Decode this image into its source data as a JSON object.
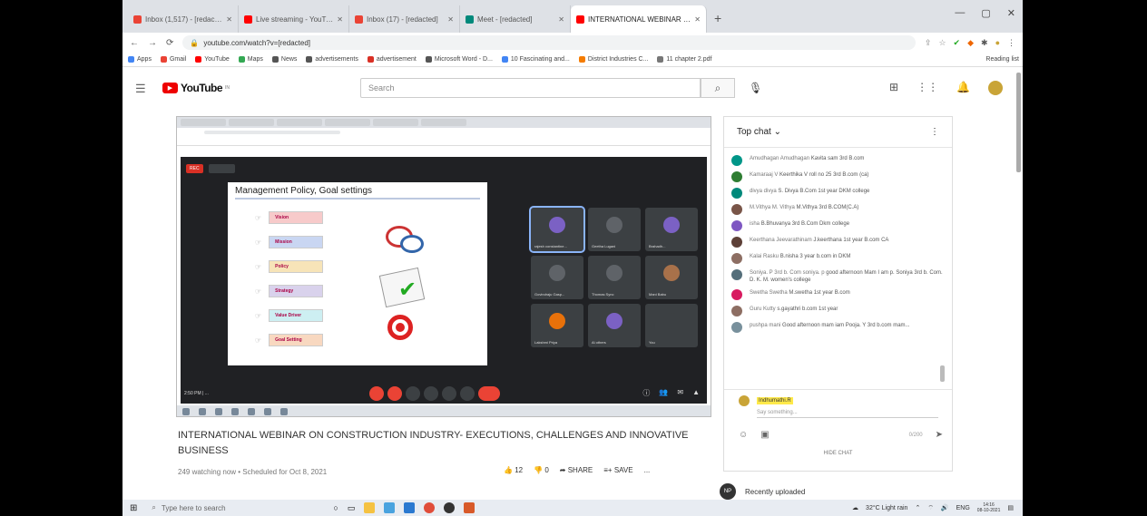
{
  "browser": {
    "tabs": [
      {
        "title": "Inbox (1,517) - [redacted]",
        "color": "#ea4335",
        "active": false
      },
      {
        "title": "Live streaming - YouTube Studio",
        "color": "#ff0000",
        "active": false
      },
      {
        "title": "Inbox (17) - [redacted]",
        "color": "#ea4335",
        "active": false
      },
      {
        "title": "Meet - [redacted]",
        "color": "#00897b",
        "active": false
      },
      {
        "title": "INTERNATIONAL WEBINAR ON C",
        "color": "#ff0000",
        "active": true
      }
    ],
    "url": "youtube.com/watch?v=[redacted]",
    "bookmarks": [
      "Apps",
      "Gmail",
      "YouTube",
      "Maps",
      "News",
      "advertisements",
      "advertisement",
      "Microsoft Word - D...",
      "10 Fascinating and...",
      "District Industries C...",
      "11 chapter 2.pdf"
    ],
    "reading_list": "Reading list"
  },
  "youtube": {
    "logo_text": "YouTube",
    "logo_sup": "IN",
    "search_placeholder": "Search"
  },
  "video": {
    "meeting_rec": "REC",
    "slide_title": "Management Policy, Goal settings",
    "bullets": [
      "Vision",
      "Mission",
      "Policy",
      "Strategy",
      "Value Driver",
      "Goal Setting"
    ],
    "participants": [
      {
        "name": "rajesh constantine...",
        "color": "#7b61c4"
      },
      {
        "name": "Geetha Lugani",
        "color": "#5f6368"
      },
      {
        "name": "Brahadh...",
        "color": "#7b61c4"
      },
      {
        "name": "Govindraju Gasp...",
        "color": "#5f6368"
      },
      {
        "name": "Thomas Sync",
        "color": "#5f6368"
      },
      {
        "name": "Mani Babu",
        "color": "#a8714a"
      },
      {
        "name": "Lakshmi Priya",
        "color": "#e8710a"
      },
      {
        "name": "Al others",
        "color": "#7b61c4"
      },
      {
        "name": "You",
        "color": "#3c4043"
      }
    ],
    "time": "2:50 PM | ..."
  },
  "video_info": {
    "title": "INTERNATIONAL WEBINAR ON CONSTRUCTION INDUSTRY- EXECUTIONS, CHALLENGES AND INNOVATIVE BUSINESS",
    "meta": "249 watching now • Scheduled for Oct 8, 2021",
    "likes": "12",
    "dislikes": "0",
    "share": "SHARE",
    "save": "SAVE",
    "more": "..."
  },
  "chat": {
    "header": "Top chat",
    "messages": [
      {
        "author": "Amudhagan Amudhagan",
        "text": "Kavita sam 3rd B.com",
        "color": "#009688"
      },
      {
        "author": "Kamaraaj V",
        "text": "Keerthika V roll no 25 3rd B.com (ca)",
        "color": "#2e7d32"
      },
      {
        "author": "divya divya",
        "text": "S. Divya B.Com 1st year DKM college",
        "color": "#00897b"
      },
      {
        "author": "M.Vithya M. Vithya",
        "text": "M.Vithya 3rd B.COM(C.A)",
        "color": "#795548"
      },
      {
        "author": "isha",
        "text": "B.Bhuvanya 3rd B.Com Dkm college",
        "color": "#7e57c2"
      },
      {
        "author": "Keerthana Jeevarathinam",
        "text": "J.keerthana 1st year B.com CA",
        "color": "#5d4037"
      },
      {
        "author": "Kalai Rasku",
        "text": "B.nisha 3 year b.com in DKM",
        "color": "#8d6e63"
      },
      {
        "author": "Soniya. P 3rd b. Com soniya. p",
        "text": "good afternoon Mam I am p. Soniya 3rd b. Com. D. K. M. women's college",
        "color": "#546e7a"
      },
      {
        "author": "Swetha Swetha",
        "text": "M.swetha 1st year B.com",
        "color": "#d81b60"
      },
      {
        "author": "Guru Kutty",
        "text": "s.gayathri b.com 1st year",
        "color": "#8d6e63"
      },
      {
        "author": "pushpa mani",
        "text": "Good afternoon mam iam Pooja. Y 3rd b.com mam...",
        "color": "#78909c"
      }
    ],
    "me_name": "Indhumathi.R",
    "say_placeholder": "Say something...",
    "char_count": "0/200",
    "hide_chat": "HIDE CHAT"
  },
  "recently_uploaded": "Recently uploaded",
  "taskbar": {
    "search_placeholder": "Type here to search",
    "weather": "32°C Light rain",
    "lang": "ENG",
    "time": "14:16",
    "date": "08-10-2021"
  }
}
